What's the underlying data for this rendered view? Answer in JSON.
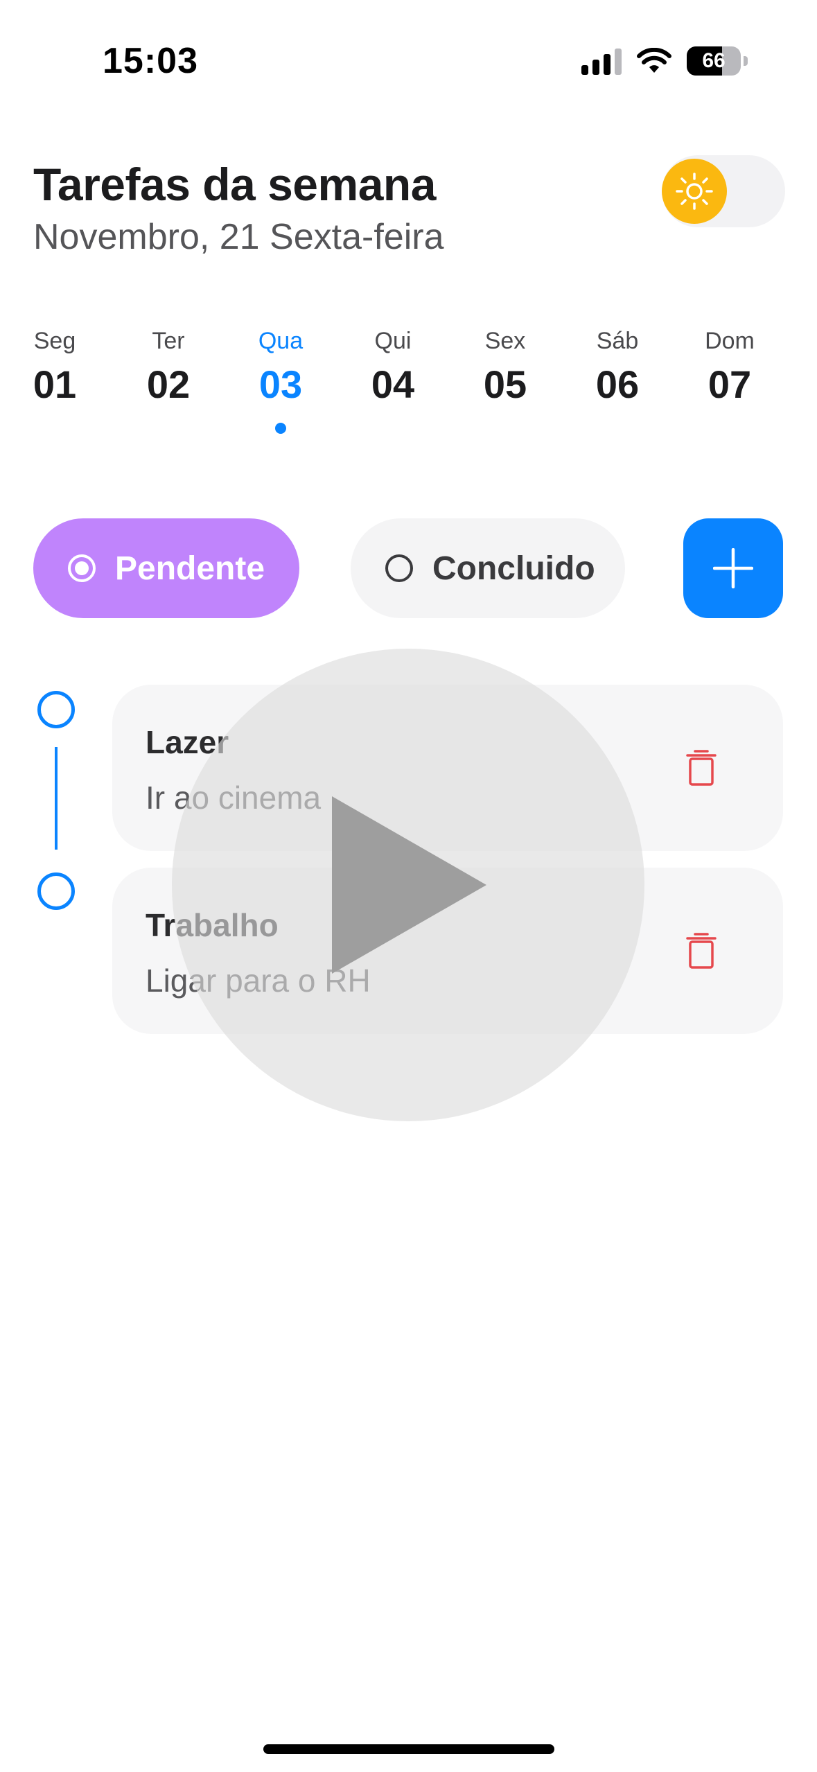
{
  "status_bar": {
    "time": "15:03",
    "battery_level": "66",
    "battery_fraction": 0.66,
    "signal_bars_active": 3,
    "signal_bars_total": 4,
    "icons": [
      "cellular-signal-icon",
      "wifi-icon",
      "battery-icon"
    ]
  },
  "header": {
    "title": "Tarefas da semana",
    "subtitle": "Novembro, 21 Sexta-feira",
    "theme_toggle_icon": "sun-icon",
    "theme_color": "#fbb810"
  },
  "week": {
    "days": [
      {
        "name": "Seg",
        "number": "01"
      },
      {
        "name": "Ter",
        "number": "02"
      },
      {
        "name": "Qua",
        "number": "03"
      },
      {
        "name": "Qui",
        "number": "04"
      },
      {
        "name": "Sex",
        "number": "05"
      },
      {
        "name": "Sáb",
        "number": "06"
      },
      {
        "name": "Dom",
        "number": "07"
      }
    ],
    "selected_index": 2,
    "accent_color": "#0a84ff"
  },
  "filters": {
    "pending_label": "Pendente",
    "done_label": "Concluido",
    "selected": "Pendente",
    "pending_color": "#c084fc",
    "add_icon": "plus-icon"
  },
  "tasks": [
    {
      "title": "Lazer",
      "description": "Ir ao cinema",
      "action_icon": "trash-icon"
    },
    {
      "title": "Trabalho",
      "description": "Ligar para o RH",
      "action_icon": "trash-icon"
    }
  ],
  "overlay": {
    "icon": "play-icon"
  },
  "colors": {
    "danger": "#e5484d"
  }
}
